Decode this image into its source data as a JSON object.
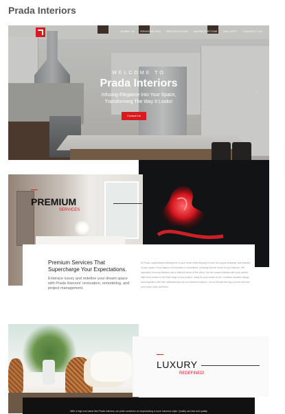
{
  "page": {
    "title": "Prada Interiors"
  },
  "hero": {
    "nav": [
      "HOME US",
      "REMODELING",
      "RENOVATIONS",
      "MARBLE/STONE",
      "GALLERY",
      "CONTACT US"
    ],
    "welcome": "WELCOME TO",
    "brand": "Prada Interiors",
    "tagline_1": "Infusing Elegance Into Your Space,",
    "tagline_2": "Transforming The Way It Looks!",
    "cta": "Contact Us",
    "next_arrow": "›"
  },
  "premium": {
    "title": "PREMIUM",
    "subtitle": "SERVICES",
    "heading_1": "Premium Services That",
    "heading_2": "Supercharge Your Expectations.",
    "body": "Embrace luxury and redefine your dream space with Prada Interiors' renovation, remodeling, and project management.",
    "detail": "At Prada, sophisticated atmosphere to your home while keeping in mind the unique character and features of your space. Every aspect of renovation is considered, ensuring that the result of your interiors. We specialize in luxury kitchens and a selected vision of the client. We mix unique features with your perfect style from scratch to the final stage of your project, ready for your dream home. Combine beautiful design and inspiration with fine craftsmanship with our tailored solutions. Let us elevate the way you live and how your home looks and feels."
  },
  "luxury": {
    "title": "LUXURY",
    "subtitle": "REDEFINED!",
    "footer_text": "With a high-end name like Prada Interiors, we pride ourselves on emphasizing a more luxurious style. Quality can last and quality"
  },
  "colors": {
    "accent": "#d71920",
    "dark": "#121314"
  }
}
